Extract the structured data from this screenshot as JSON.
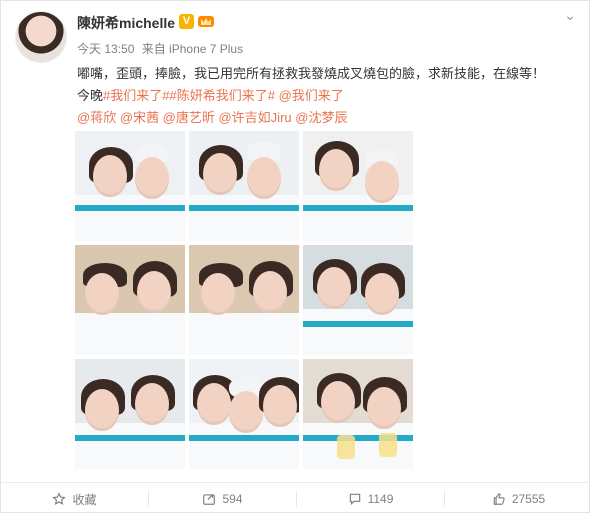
{
  "post": {
    "username": "陳妍希michelle",
    "meta": {
      "time": "今天 13:50",
      "source": "来自 iPhone 7 Plus"
    },
    "content": {
      "line1": "嘟嘴，歪頭，捧臉，我已用完所有拯救我發燒成叉燒包的臉，求新技能，在線等！",
      "line2_prefix": "今晚",
      "hashtag1": "#我们来了#",
      "hashtag2": "#陈妍希我们来了#",
      "mention_inline": "@我们来了",
      "mentions": [
        "@蒋欣",
        "@宋茜",
        "@唐艺昕",
        "@许吉如Jiru",
        "@沈梦辰"
      ]
    },
    "actions": {
      "favorite": "收藏",
      "repost_count": "594",
      "comment_count": "1149",
      "like_count": "27555"
    }
  }
}
